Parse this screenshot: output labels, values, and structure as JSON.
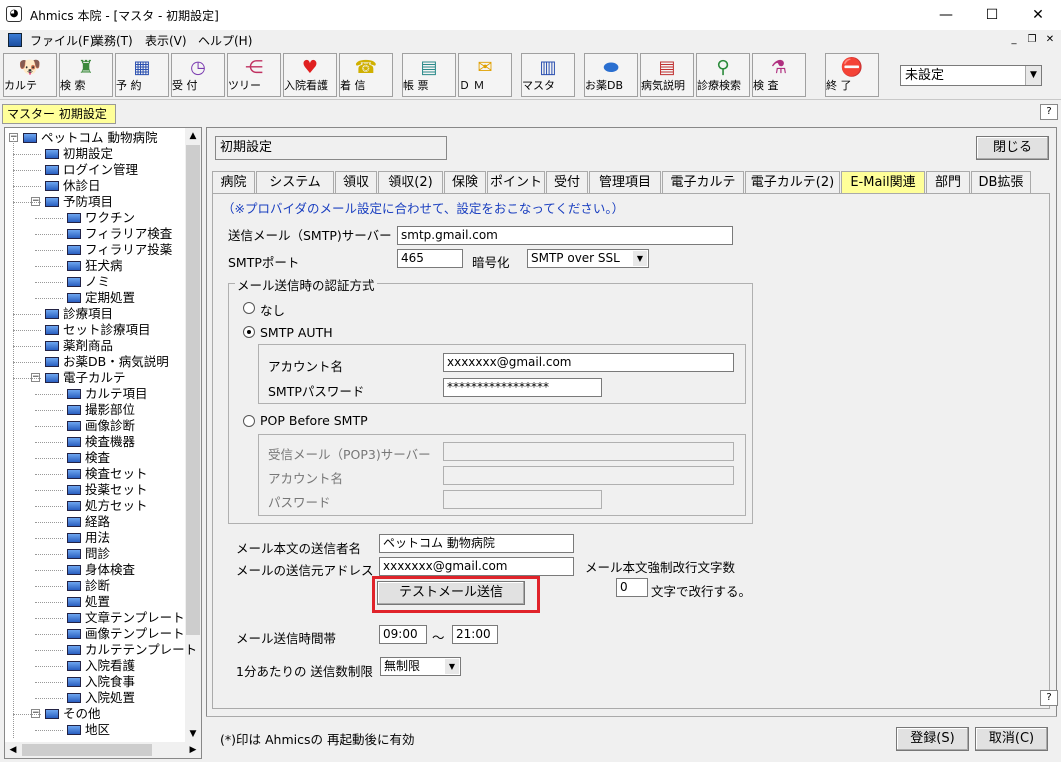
{
  "window": {
    "title": "Ahmics 本院 - [マスタ - 初期設定]",
    "minimize": "—",
    "maximize": "☐",
    "close": "✕"
  },
  "menu": {
    "items": [
      "ファイル(F)",
      "業務(T)",
      "表示(V)",
      "ヘルプ(H)"
    ]
  },
  "toolbar": {
    "buttons": [
      {
        "label": "カルテ",
        "icon": "dog-icon"
      },
      {
        "label": "検 索",
        "icon": "binoculars-icon"
      },
      {
        "label": "予 約",
        "icon": "calendar-icon"
      },
      {
        "label": "受 付",
        "icon": "clock-icon"
      },
      {
        "label": "ツリー",
        "icon": "tree-icon"
      },
      {
        "label": "入院看護",
        "icon": "heart-plus-icon"
      },
      {
        "label": "着 信",
        "icon": "phone-icon"
      },
      {
        "label": "帳 票",
        "icon": "document-icon"
      },
      {
        "label": "Ｄ Ｍ",
        "icon": "mail-icon"
      },
      {
        "label": "マスタ",
        "icon": "book-icon"
      },
      {
        "label": "お薬DB",
        "icon": "pill-icon"
      },
      {
        "label": "病気説明",
        "icon": "report-icon"
      },
      {
        "label": "診療検索",
        "icon": "magnifier-icon"
      },
      {
        "label": "検 査",
        "icon": "flask-icon"
      },
      {
        "label": "終 了",
        "icon": "stop-icon"
      }
    ],
    "combo_value": "未設定"
  },
  "doc_tab": "マスター 初期設定",
  "tree": {
    "items": [
      {
        "label": "ペットコム 動物病院",
        "level": 0
      },
      {
        "label": "初期設定",
        "level": 1
      },
      {
        "label": "ログイン管理",
        "level": 1
      },
      {
        "label": "休診日",
        "level": 1
      },
      {
        "label": "予防項目",
        "level": 1
      },
      {
        "label": "ワクチン",
        "level": 2
      },
      {
        "label": "フィラリア検査",
        "level": 2
      },
      {
        "label": "フィラリア投薬",
        "level": 2
      },
      {
        "label": "狂犬病",
        "level": 2
      },
      {
        "label": "ノミ",
        "level": 2
      },
      {
        "label": "定期処置",
        "level": 2
      },
      {
        "label": "診療項目",
        "level": 1
      },
      {
        "label": "セット診療項目",
        "level": 1
      },
      {
        "label": "薬剤商品",
        "level": 1
      },
      {
        "label": "お薬DB・病気説明",
        "level": 1
      },
      {
        "label": "電子カルテ",
        "level": 1
      },
      {
        "label": "カルテ項目",
        "level": 2
      },
      {
        "label": "撮影部位",
        "level": 2
      },
      {
        "label": "画像診断",
        "level": 2
      },
      {
        "label": "検査機器",
        "level": 2
      },
      {
        "label": "検査",
        "level": 2
      },
      {
        "label": "検査セット",
        "level": 2
      },
      {
        "label": "投薬セット",
        "level": 2
      },
      {
        "label": "処方セット",
        "level": 2
      },
      {
        "label": "経路",
        "level": 2
      },
      {
        "label": "用法",
        "level": 2
      },
      {
        "label": "問診",
        "level": 2
      },
      {
        "label": "身体検査",
        "level": 2
      },
      {
        "label": "診断",
        "level": 2
      },
      {
        "label": "処置",
        "level": 2
      },
      {
        "label": "文章テンプレート",
        "level": 2
      },
      {
        "label": "画像テンプレート",
        "level": 2
      },
      {
        "label": "カルテテンプレート",
        "level": 2
      },
      {
        "label": "入院看護",
        "level": 2
      },
      {
        "label": "入院食事",
        "level": 2
      },
      {
        "label": "入院処置",
        "level": 2
      },
      {
        "label": "その他",
        "level": 1
      },
      {
        "label": "地区",
        "level": 2
      }
    ]
  },
  "panel": {
    "title": "初期設定",
    "close_label": "閉じる",
    "tabs": [
      "病院",
      "システム",
      "領収",
      "領収(2)",
      "保険",
      "ポイント",
      "受付",
      "管理項目",
      "電子カルテ",
      "電子カルテ(2)",
      "E-Mail関連",
      "部門",
      "DB拡張"
    ],
    "active_tab": "E-Mail関連"
  },
  "email": {
    "note": "（※プロバイダのメール設定に合わせて、設定をおこなってください。）",
    "smtp_server_label": "送信メール（SMTP)サーバー",
    "smtp_server": "smtp.gmail.com",
    "smtp_port_label": "SMTPポート",
    "smtp_port": "465",
    "encryption_label": "暗号化",
    "encryption": "SMTP over SSL",
    "auth_group": "メール送信時の認証方式",
    "auth_none": "なし",
    "auth_smtp": "SMTP AUTH",
    "account_label": "アカウント名",
    "account": "xxxxxxx@gmail.com",
    "smtp_password_label": "SMTPパスワード",
    "smtp_password": "*****************",
    "auth_pop": "POP Before SMTP",
    "pop_server_label": "受信メール（POP3)サーバー",
    "pop_account_label": "アカウント名",
    "pop_password_label": "パスワード",
    "sender_name_label": "メール本文の送信者名",
    "sender_name": "ペットコム 動物病院",
    "sender_address_label": "メールの送信元アドレス",
    "sender_address": "xxxxxxx@gmail.com",
    "wrap_label": "メール本文強制改行文字数",
    "wrap_value": "0",
    "wrap_suffix": "文字で改行する。",
    "test_button": "テストメール送信",
    "time_label": "メール送信時間帯",
    "time_from": "09:00",
    "time_sep": "～",
    "time_to": "21:00",
    "limit_label": "1分あたりの 送信数制限",
    "limit_value": "無制限"
  },
  "status": {
    "note": "(*)印は Ahmicsの 再起動後に有効",
    "register": "登録(S)",
    "cancel": "取消(C)"
  },
  "colors": {
    "highlight": "#e0232a",
    "active_tab": "#ffff99",
    "note_text": "#1a3fc0"
  }
}
